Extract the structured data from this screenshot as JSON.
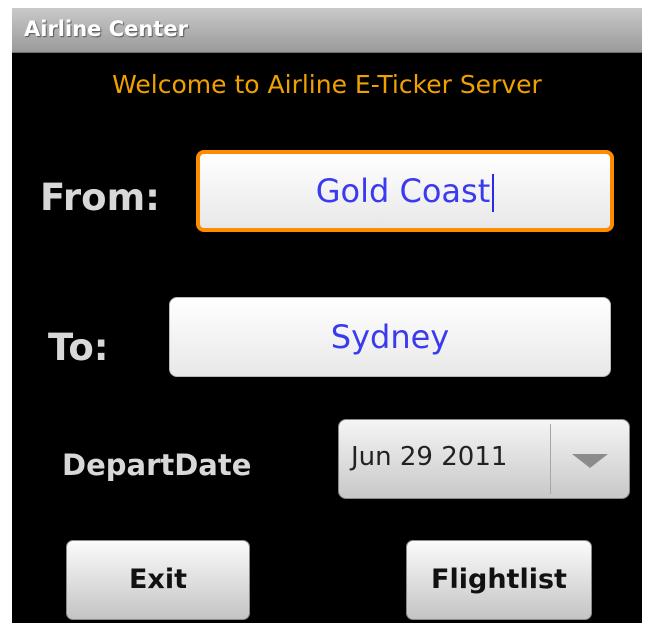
{
  "app": {
    "title": "Airline Center",
    "welcome": "Welcome to Airline E-Ticker Server"
  },
  "form": {
    "from_label": "From:",
    "from_value": "Gold Coast",
    "to_label": "To:",
    "to_value": "Sydney",
    "date_label": "DepartDate",
    "date_value": "Jun 29 2011"
  },
  "buttons": {
    "exit": "Exit",
    "flightlist": "Flightlist"
  },
  "colors": {
    "welcome": "#f0a000",
    "focus_border": "#ff8c00",
    "field_text": "#3a3aef"
  },
  "icons": {
    "spinner": "chevron-down-icon"
  }
}
